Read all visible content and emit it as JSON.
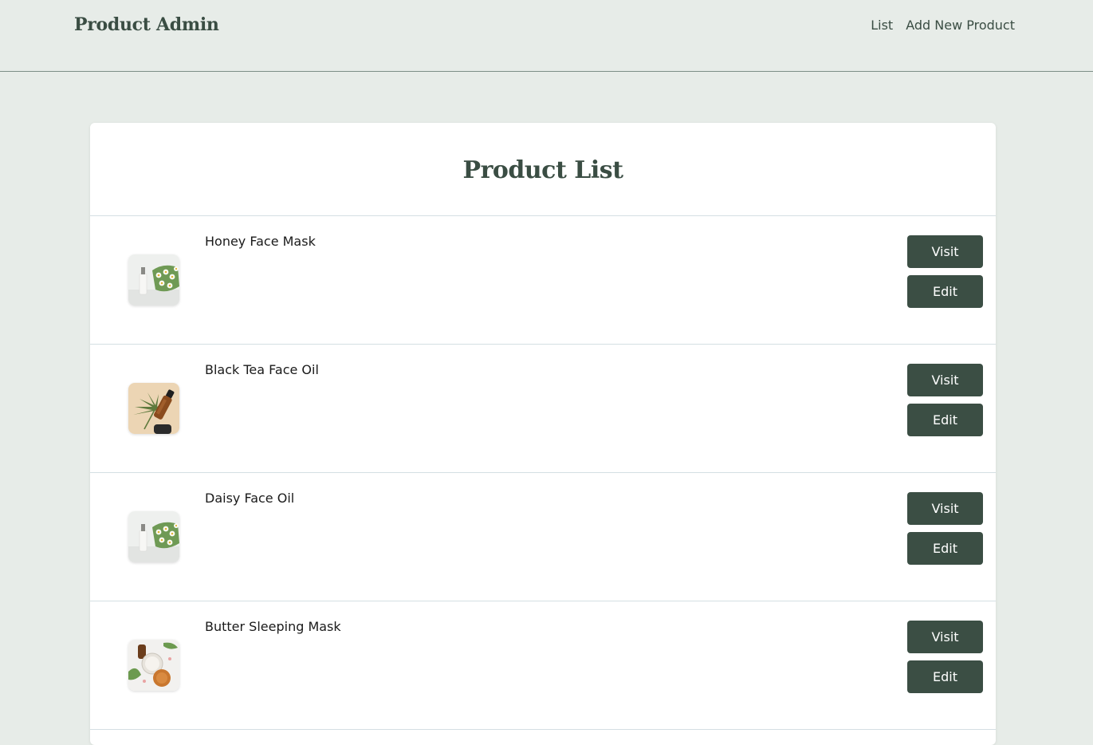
{
  "header": {
    "brand": "Product Admin",
    "nav": [
      "List",
      "Add New Product"
    ]
  },
  "main": {
    "title": "Product List",
    "visit_label": "Visit",
    "edit_label": "Edit",
    "products": [
      {
        "name": "Honey Face Mask",
        "image": "daisy-bottle-image"
      },
      {
        "name": "Black Tea Face Oil",
        "image": "dropper-leaf-image"
      },
      {
        "name": "Daisy Face Oil",
        "image": "daisy-bottle-image"
      },
      {
        "name": "Butter Sleeping Mask",
        "image": "cream-jars-image"
      }
    ]
  },
  "colors": {
    "background": "#e7ece8",
    "accent": "#3b4e44",
    "card": "#ffffff"
  }
}
